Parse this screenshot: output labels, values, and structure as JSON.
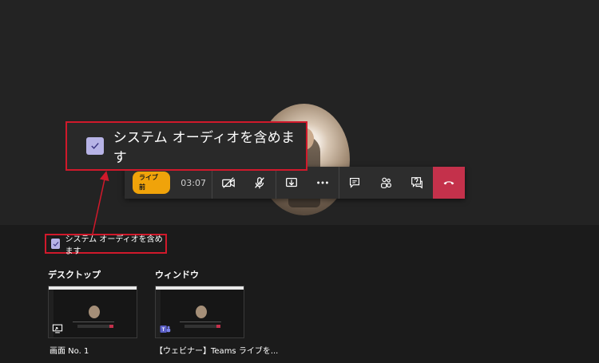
{
  "stage": {
    "callbar": {
      "status_badge": "ライブ前",
      "timer": "03:07",
      "buttons": [
        "video-off-icon",
        "mic-off-icon",
        "share-tray-icon",
        "more-icon",
        "chat-icon",
        "people-icon",
        "qna-icon",
        "hangup-icon"
      ],
      "hangup_color": "#c4314b",
      "badge_color": "#f0a30a"
    }
  },
  "callout": {
    "label": "システム オーディオを含めます",
    "checked": true,
    "highlight_color": "#d0192b"
  },
  "tray": {
    "include_audio": {
      "label": "システム オーディオを含めます",
      "checked": true
    },
    "desktop": {
      "title": "デスクトップ",
      "items": [
        {
          "caption": "画面 No. 1",
          "icon": "screen-share-icon"
        }
      ]
    },
    "window": {
      "title": "ウィンドウ",
      "items": [
        {
          "caption": "【ウェビナー】Teams ライブを...",
          "icon": "teams-icon"
        }
      ]
    }
  },
  "colors": {
    "checkbox": "#b7b3e6",
    "background": "#1f1f1f"
  }
}
